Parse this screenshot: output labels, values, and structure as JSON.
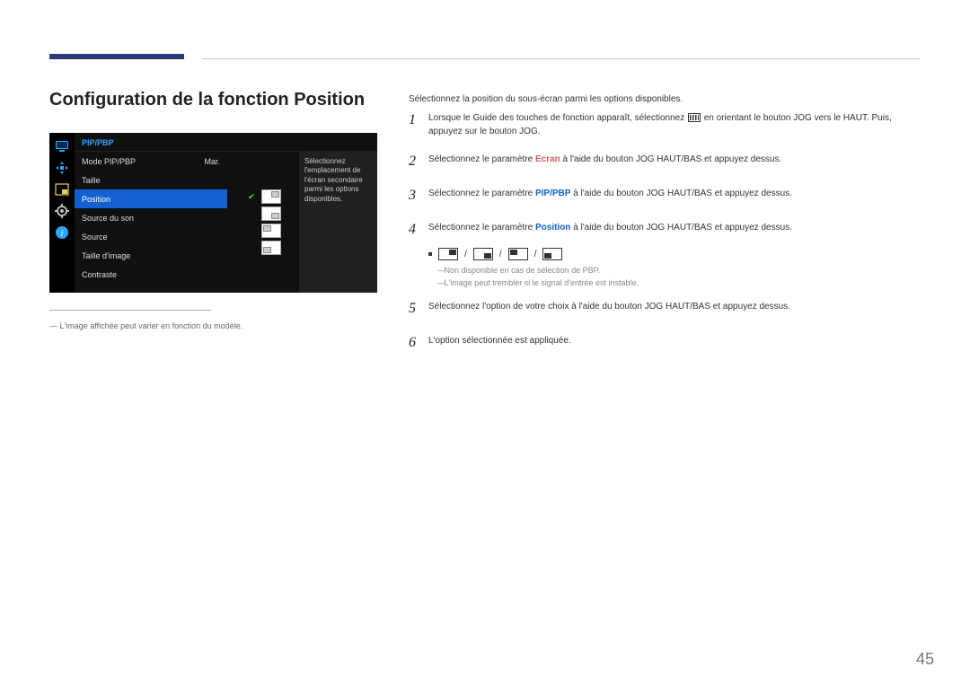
{
  "title": "Configuration de la fonction Position",
  "osd": {
    "header": "PIP/PBP",
    "items": [
      {
        "label": "Mode PIP/PBP",
        "value": "Mar."
      },
      {
        "label": "Taille",
        "value": ""
      },
      {
        "label": "Position",
        "value": ""
      },
      {
        "label": "Source du son",
        "value": ""
      },
      {
        "label": "Source",
        "value": ""
      },
      {
        "label": "Taille d'image",
        "value": ""
      },
      {
        "label": "Contraste",
        "value": ""
      }
    ],
    "help": "Sélectionnez l'emplacement de l'écran secondaire parmi les options disponibles."
  },
  "note": "L'image affichée peut varier en fonction du modèle.",
  "intro": "Sélectionnez la position du sous-écran parmi les options disponibles.",
  "steps": {
    "s1a": "Lorsque le Guide des touches de fonction apparaît, sélectionnez ",
    "s1b": " en orientant le bouton JOG vers le HAUT. Puis, appuyez sur le bouton JOG.",
    "s2a": "Sélectionnez le paramètre ",
    "s2hl": "Ecran",
    "s2b": " à l'aide du bouton JOG HAUT/BAS et appuyez dessus.",
    "s3a": "Sélectionnez le paramètre ",
    "s3hl": "PIP/PBP",
    "s3b": " à l'aide du bouton JOG HAUT/BAS et appuyez dessus.",
    "s4a": "Sélectionnez le paramètre ",
    "s4hl": "Position",
    "s4b": " à l'aide du bouton JOG HAUT/BAS et appuyez dessus.",
    "sub1": "Non disponible en cas de sélection de PBP.",
    "sub2": "L'image peut trembler si le signal d'entrée est instable.",
    "s5": "Sélectionnez l'option de votre choix à l'aide du bouton JOG HAUT/BAS et appuyez dessus.",
    "s6": "L'option sélectionnée est appliquée."
  },
  "page": "45"
}
